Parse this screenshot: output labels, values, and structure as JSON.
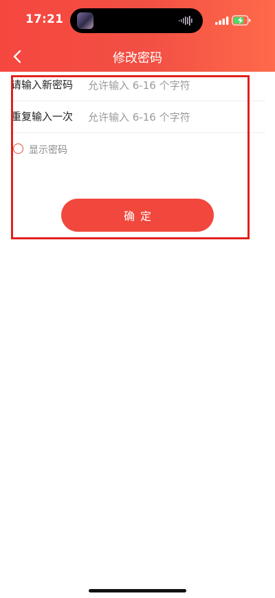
{
  "status_bar": {
    "time": "17:21"
  },
  "nav": {
    "title": "修改密码",
    "back_icon": "chevron-left-icon"
  },
  "form": {
    "new_password": {
      "label": "请输入新密码",
      "placeholder": "允许输入 6-16 个字符",
      "value": ""
    },
    "repeat_password": {
      "label": "重复输入一次",
      "placeholder": "允许输入 6-16 个字符",
      "value": ""
    },
    "show_password": {
      "label": "显示密码",
      "checked": false
    }
  },
  "confirm_button": {
    "label": "确定"
  },
  "colors": {
    "header_start": "#f5473f",
    "header_end": "#ff6a4a",
    "accent": "#f2473c",
    "highlight_box": "#e0201a"
  }
}
